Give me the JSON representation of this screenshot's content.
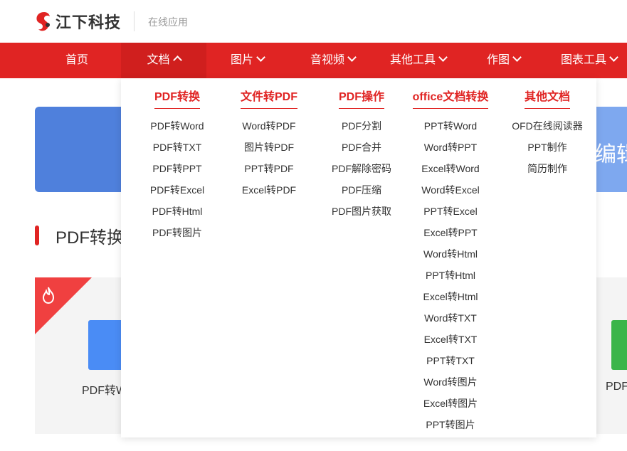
{
  "header": {
    "logo_text": "江下科技",
    "subtitle": "在线应用",
    "brand_color": "#e02423"
  },
  "nav": {
    "items": [
      {
        "label": "首页"
      },
      {
        "label": "文档"
      },
      {
        "label": "图片"
      },
      {
        "label": "音视频"
      },
      {
        "label": "其他工具"
      },
      {
        "label": "作图"
      },
      {
        "label": "图表工具"
      }
    ]
  },
  "dropdown": {
    "columns": [
      {
        "title": "PDF转换",
        "items": [
          "PDF转Word",
          "PDF转TXT",
          "PDF转PPT",
          "PDF转Excel",
          "PDF转Html",
          "PDF转图片"
        ]
      },
      {
        "title": "文件转PDF",
        "items": [
          "Word转PDF",
          "图片转PDF",
          "PPT转PDF",
          "Excel转PDF"
        ]
      },
      {
        "title": "PDF操作",
        "items": [
          "PDF分割",
          "PDF合并",
          "PDF解除密码",
          "PDF压缩",
          "PDF图片获取"
        ]
      },
      {
        "title": "office文档转换",
        "items": [
          "PPT转Word",
          "Word转PPT",
          "Excel转Word",
          "Word转Excel",
          "PPT转Excel",
          "Excel转PPT",
          "Word转Html",
          "PPT转Html",
          "Excel转Html",
          "Word转TXT",
          "Excel转TXT",
          "PPT转TXT",
          "Word转图片",
          "Excel转图片",
          "PPT转图片"
        ]
      },
      {
        "title": "其他文档",
        "items": [
          "OFD在线阅读器",
          "PPT制作",
          "简历制作"
        ]
      }
    ]
  },
  "page": {
    "banner_partial_text": "编辑",
    "section_title": "PDF转换",
    "card_left_label": "PDF转W",
    "card_right_label": "PDF"
  }
}
